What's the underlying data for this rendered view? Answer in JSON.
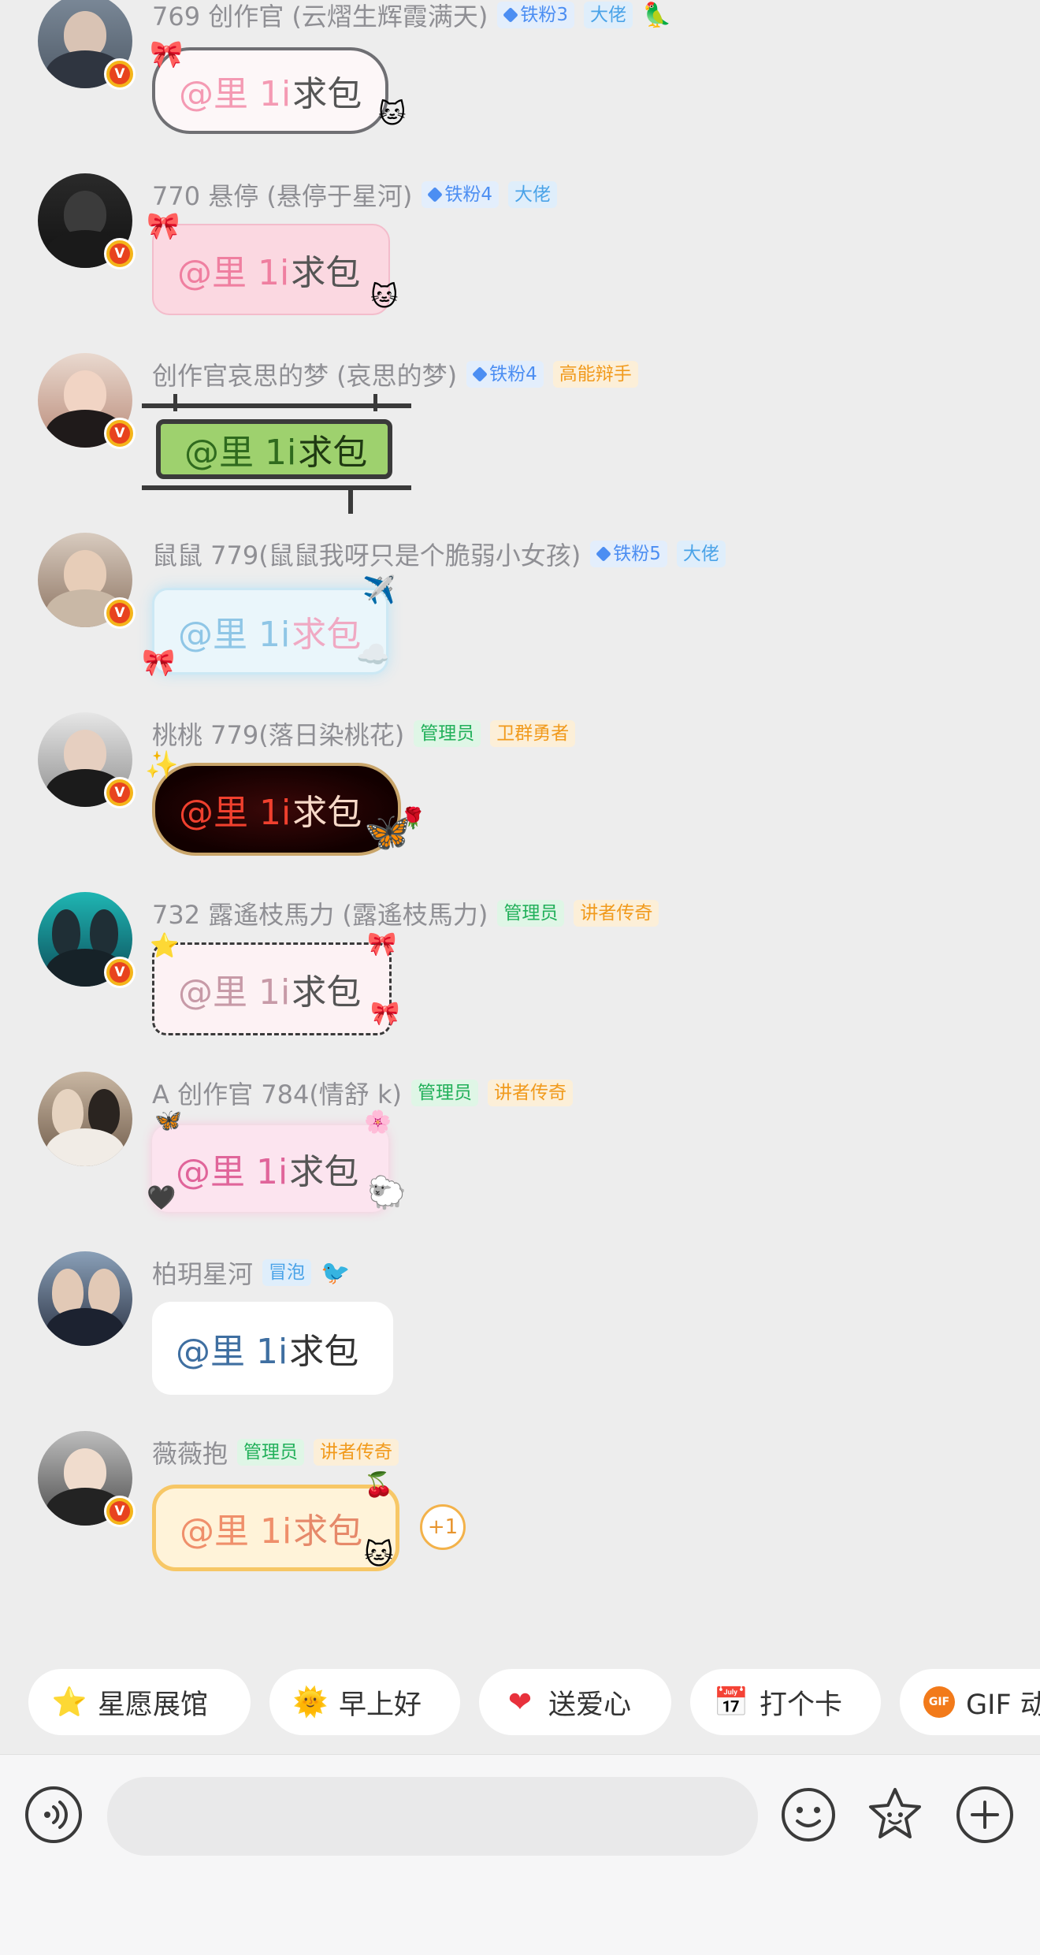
{
  "messages": [
    {
      "name": "769 创作官 (云熠生辉霞满天)",
      "tags": [
        "铁粉3",
        "大佬"
      ],
      "text": "求包",
      "mention": "@里 1i"
    },
    {
      "name": "770 悬停 (悬停于星河)",
      "tags": [
        "铁粉4",
        "大佬"
      ],
      "text": "求包",
      "mention": "@里 1i"
    },
    {
      "name": "创作官哀思的梦 (哀思的梦)",
      "tags": [
        "铁粉4",
        "高能辩手"
      ],
      "text": "求包",
      "mention": "@里 1i"
    },
    {
      "name": "鼠鼠 779(鼠鼠我呀只是个脆弱小女孩)",
      "tags": [
        "铁粉5",
        "大佬"
      ],
      "text": "求包",
      "mention": "@里 1i"
    },
    {
      "name": "桃桃 779(落日染桃花)",
      "tags": [
        "管理员",
        "卫群勇者"
      ],
      "text": "求包",
      "mention": "@里 1i"
    },
    {
      "name": "732 露遙枝馬力 (露遙枝馬力)",
      "tags": [
        "管理员",
        "讲者传奇"
      ],
      "text": "求包",
      "mention": "@里 1i"
    },
    {
      "name": "A 创作官 784(情舒 k)",
      "tags": [
        "管理员",
        "讲者传奇"
      ],
      "text": "求包",
      "mention": "@里 1i"
    },
    {
      "name": "柏玥星河",
      "tags": [
        "冒泡"
      ],
      "text": "求包",
      "mention": "@里 1i"
    },
    {
      "name": "薇薇抱",
      "tags": [
        "管理员",
        "讲者传奇"
      ],
      "text": "求包",
      "mention": "@里 1i",
      "reaction": "+1"
    }
  ],
  "verified_badge": "V",
  "shortcuts": [
    {
      "label": "星愿展馆",
      "icon": "star-icon"
    },
    {
      "label": "早上好",
      "icon": "sun-face-icon"
    },
    {
      "label": "送爱心",
      "icon": "heart-icon"
    },
    {
      "label": "打个卡",
      "icon": "calendar-check-icon"
    },
    {
      "label": "GIF 动",
      "icon": "gif-icon"
    }
  ],
  "colors": {
    "accent_blue": "#4c8ef2",
    "admin_green": "#22b05a",
    "title_orange": "#f19a1c",
    "badge_red": "#e8431e"
  }
}
